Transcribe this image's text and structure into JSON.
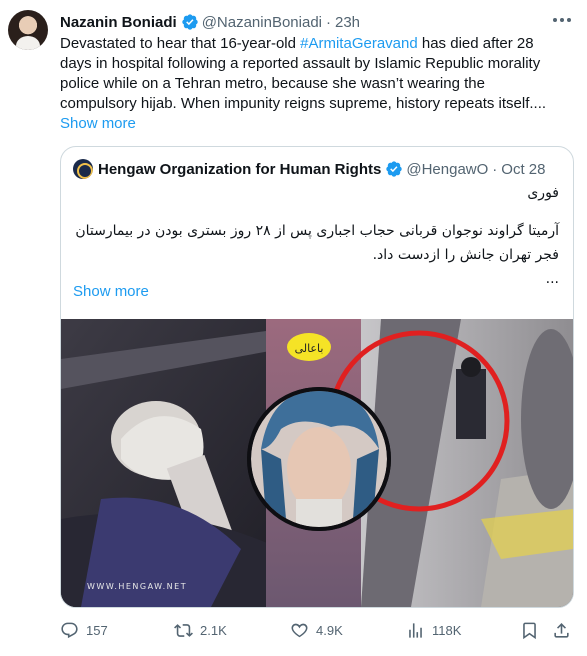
{
  "tweet": {
    "author_name": "Nazanin Boniadi",
    "author_handle": "@NazaninBoniadi",
    "time": "23h",
    "text_lines": [
      {
        "before": "Devastated to hear that 16-year-old ",
        "hashtag": "#ArmitaGeravand",
        "after": " has died after 28"
      },
      {
        "text": "days in hospital following a reported assault by Islamic Republic morality"
      },
      {
        "text": "police while on a Tehran metro, because she wasn’t wearing the"
      },
      {
        "text": "compulsory hijab. When impunity reigns supreme, history repeats itself...."
      }
    ],
    "show_more": "Show more"
  },
  "quote": {
    "name": "Hengaw Organization for Human Rights",
    "handle": "@HengawO",
    "time": "Oct 28",
    "line1": "فوری",
    "line2": "آرمیتا گراوند نوجوان قربانی حجاب اجباری پس از ۲۸ روز بستری بودن در بیمارستان",
    "line3": "فجر تهران جانش را ازدست داد.",
    "line4": "...",
    "show_more": "Show more",
    "media": {
      "watermark": "WWW.HENGAW.NET",
      "sign_text": "باعالی"
    }
  },
  "actions": {
    "replies": "157",
    "retweets": "2.1K",
    "likes": "4.9K",
    "views": "118K"
  },
  "colors": {
    "accent": "#1d9bf0",
    "muted": "#536471",
    "border": "#cfd9de",
    "highlight_circle": "#e02020"
  },
  "icons": [
    "verified-badge-icon",
    "more-icon",
    "reply-icon",
    "retweet-icon",
    "like-icon",
    "views-icon",
    "bookmark-icon",
    "share-icon"
  ]
}
